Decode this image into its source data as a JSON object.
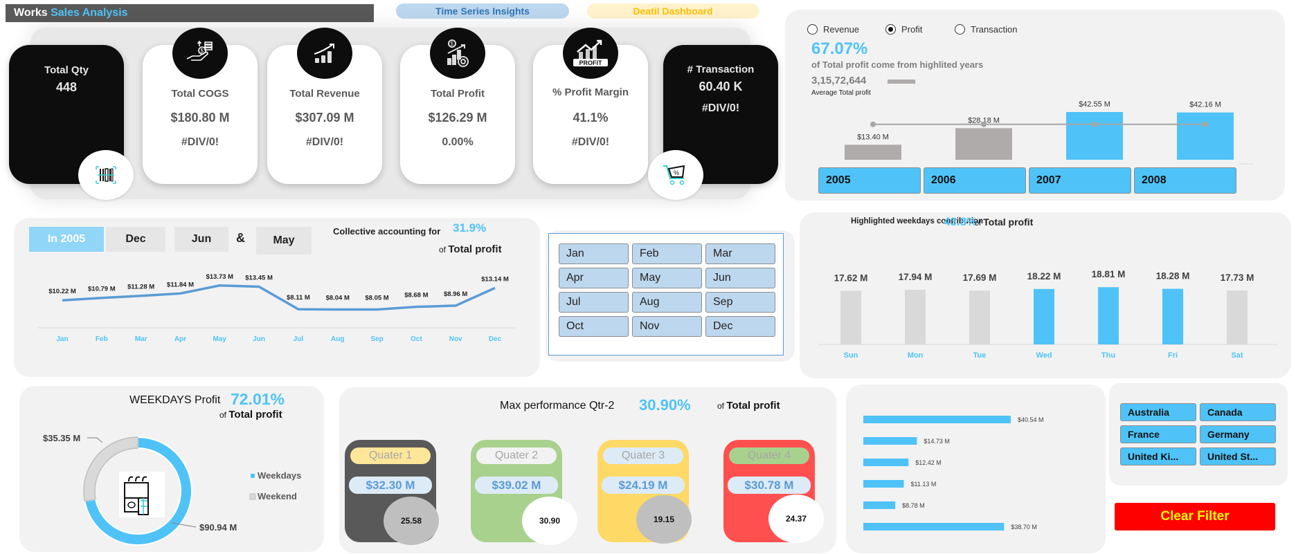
{
  "header": {
    "title_prefix": "Works",
    "title_accent": "Sales Analysis",
    "nav": [
      {
        "label": "Time Series Insights"
      },
      {
        "label": "Deatil Dashboard"
      }
    ]
  },
  "kpis": [
    {
      "label": "Total Qty",
      "value": "448",
      "sub": "",
      "style": "dark",
      "icon": "barcode-icon"
    },
    {
      "label": "Total COGS",
      "value": "$180.80 M",
      "sub": "#DIV/0!",
      "style": "light",
      "icon": "hand-money-icon"
    },
    {
      "label": "Total Revenue",
      "value": "$307.09 M",
      "sub": "#DIV/0!",
      "style": "light",
      "icon": "growth-chart-icon"
    },
    {
      "label": "Total Profit",
      "value": "$126.29 M",
      "sub": "0.00%",
      "style": "light",
      "icon": "profit-coin-icon"
    },
    {
      "label": "% Profit Margin",
      "value": "41.1%",
      "sub": "#DIV/0!",
      "style": "light",
      "icon": "profit-chart-icon"
    },
    {
      "label": "# Transaction",
      "value": "60.40 K",
      "sub": "#DIV/0!",
      "style": "dark",
      "icon": "shopping-cart-icon"
    }
  ],
  "year_panel": {
    "radios": [
      {
        "label": "Revenue",
        "selected": false
      },
      {
        "label": "Profit",
        "selected": true
      },
      {
        "label": "Transaction",
        "selected": false
      }
    ],
    "headline_pct": "67.07%",
    "headline_text": "of  Total profit come from highlited years",
    "average_value": "3,15,72,644",
    "average_label": "Average Total profit",
    "year_buttons": [
      "2005",
      "2006",
      "2007",
      "2008"
    ]
  },
  "month_panel": {
    "tabs": [
      "In 2005",
      "Dec",
      "Jun",
      "&",
      "May"
    ],
    "caption": "Collective accounting for",
    "pct": "31.9%",
    "caption2_prefix": "of",
    "caption2_bold": "Total profit"
  },
  "month_slicer": [
    "Jan",
    "Feb",
    "Mar",
    "Apr",
    "May",
    "Jun",
    "Jul",
    "Aug",
    "Sep",
    "Oct",
    "Nov",
    "Dec"
  ],
  "weekday_panel": {
    "caption": "Highlighted weekdays contribution",
    "pct": "43.8%",
    "suffix_prefix": "of",
    "suffix_bold": "Total profit"
  },
  "donut_panel": {
    "title": "WEEKDAYS Profit",
    "pct": "72.01%",
    "sub_prefix": "of",
    "sub_bold": "Total profit"
  },
  "quarter_panel": {
    "title": "Max performance  Qtr-2",
    "pct": "30.90%",
    "sub_prefix": "of",
    "sub_bold": "Total profit",
    "quarters": [
      {
        "label": "Quater 1",
        "value": "$32.30 M",
        "share": "25.58"
      },
      {
        "label": "Quater 2",
        "value": "$39.02 M",
        "share": "30.90"
      },
      {
        "label": "Quater 3",
        "value": "$24.19 M",
        "share": "19.15"
      },
      {
        "label": "Quater 4",
        "value": "$30.78 M",
        "share": "24.37"
      }
    ]
  },
  "countries": [
    "Australia",
    "Canada",
    "France",
    "Germany",
    "United Ki...",
    "United St..."
  ],
  "clear_filter_label": "Clear Filter",
  "colors": {
    "accent_blue": "#4fc3f7",
    "grey_bar": "#afabab",
    "light_grey_bar": "#d9d9d9",
    "line_blue": "#5b9bd5",
    "clear_red": "#ff0000",
    "clear_text": "#ffff00"
  },
  "chart_data": [
    {
      "id": "yearly_profit",
      "type": "bar",
      "title": "",
      "categories": [
        "2005",
        "2006",
        "2007",
        "2008"
      ],
      "values": [
        13.4,
        28.18,
        42.55,
        42.16
      ],
      "labels": [
        "$13.40 M",
        "$28.18 M",
        "$42.55 M",
        "$42.16 M"
      ],
      "highlighted": [
        false,
        false,
        true,
        true
      ],
      "average_line": 31.57,
      "unit": "$M",
      "ylim": [
        0,
        45
      ]
    },
    {
      "id": "monthly_profit_2005",
      "type": "line",
      "categories": [
        "Jan",
        "Feb",
        "Mar",
        "Apr",
        "May",
        "Jun",
        "Jul",
        "Aug",
        "Sep",
        "Oct",
        "Nov",
        "Dec"
      ],
      "values": [
        10.22,
        10.79,
        11.28,
        11.84,
        13.73,
        13.45,
        8.11,
        8.04,
        8.05,
        8.68,
        8.96,
        13.14
      ],
      "labels": [
        "$10.22 M",
        "$10.79 M",
        "$11.28 M",
        "$11.84 M",
        "$13.73 M",
        "$13.45 M",
        "$8.11 M",
        "$8.04 M",
        "$8.05 M",
        "$8.68 M",
        "$8.96 M",
        "$13.14 M"
      ],
      "unit": "$M",
      "ylim": [
        0,
        15
      ]
    },
    {
      "id": "weekday_profit",
      "type": "bar",
      "categories": [
        "Sun",
        "Mon",
        "Tue",
        "Wed",
        "Thu",
        "Fri",
        "Sat"
      ],
      "values": [
        17.62,
        17.94,
        17.69,
        18.22,
        18.81,
        18.28,
        17.73
      ],
      "labels": [
        "17.62 M",
        "17.94 M",
        "17.69 M",
        "18.22 M",
        "18.81 M",
        "18.28 M",
        "17.73 M"
      ],
      "highlighted": [
        false,
        false,
        false,
        true,
        true,
        true,
        false
      ],
      "unit": "M",
      "ylim": [
        0,
        20
      ]
    },
    {
      "id": "weekday_weekend_split",
      "type": "pie",
      "categories": [
        "Weekdays",
        "Weekend"
      ],
      "values": [
        90.94,
        35.35
      ],
      "labels": [
        "$90.94 M",
        "$35.35 M"
      ],
      "legend": "right",
      "donut": true
    },
    {
      "id": "country_profit",
      "type": "bar",
      "orientation": "horizontal",
      "categories": [
        "Australia",
        "Canada",
        "France",
        "Germany",
        "United Kingdom",
        "United States"
      ],
      "values": [
        40.54,
        14.73,
        12.42,
        11.13,
        8.78,
        38.7
      ],
      "labels": [
        "$40.54 M",
        "$14.73 M",
        "$12.42 M",
        "$11.13 M",
        "$8.78 M",
        "$38.70 M"
      ],
      "unit": "$M",
      "xlim": [
        0,
        45
      ]
    }
  ]
}
